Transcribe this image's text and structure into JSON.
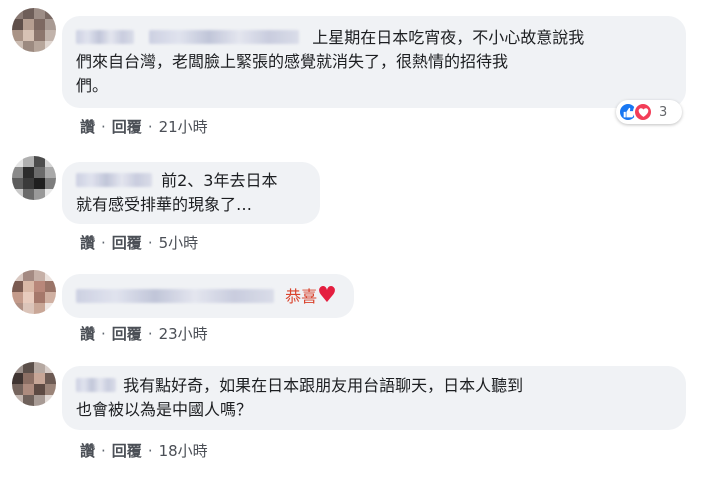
{
  "comments": [
    {
      "text_lines": [
        "上星期在日本吃宵夜，不小心故意說我",
        "們來自台灣，老闆臉上緊張的感覺就消失了，很熱情的招待我",
        "們。"
      ],
      "actions": {
        "like": "讚",
        "reply": "回覆",
        "time": "21小時"
      },
      "reaction_count": "3"
    },
    {
      "text_lines": [
        "前2、3年去日本",
        "就有感受排華的現象了…"
      ],
      "actions": {
        "like": "讚",
        "reply": "回覆",
        "time": "5小時"
      }
    },
    {
      "text": "恭喜",
      "emoji": "♥",
      "actions": {
        "like": "讚",
        "reply": "回覆",
        "time": "23小時"
      }
    },
    {
      "text_lines": [
        "我有點好奇，如果在日本跟朋友用台語聊天，日本人聽到",
        "也會被以為是中國人嗎？"
      ],
      "actions": {
        "like": "讚",
        "reply": "回覆",
        "time": "18小時"
      }
    }
  ],
  "separator": "·",
  "icons": [
    "like-icon",
    "love-icon"
  ],
  "colors": {
    "bubble": "#f0f2f5",
    "accent_red": "#d9442e",
    "like_blue": "#1877f2",
    "love_red": "#f33e58"
  }
}
